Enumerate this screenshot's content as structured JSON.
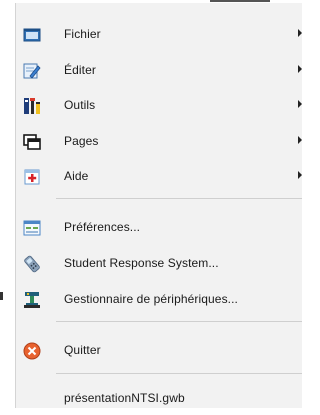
{
  "menu": {
    "items": [
      {
        "label": "Fichier",
        "icon": "folder-icon",
        "submenu": true
      },
      {
        "label": "Éditer",
        "icon": "edit-icon",
        "submenu": true
      },
      {
        "label": "Outils",
        "icon": "tools-icon",
        "submenu": true
      },
      {
        "label": "Pages",
        "icon": "pages-icon",
        "submenu": true
      },
      {
        "label": "Aide",
        "icon": "help-icon",
        "submenu": true
      },
      {
        "label": "Préférences...",
        "icon": "preferences-icon",
        "submenu": false
      },
      {
        "label": "Student Response System...",
        "icon": "response-system-icon",
        "submenu": false
      },
      {
        "label": "Gestionnaire de périphériques...",
        "icon": "device-manager-icon",
        "submenu": false
      },
      {
        "label": "Quitter",
        "icon": "quit-icon",
        "submenu": false
      },
      {
        "label": "présentationNTSI.gwb",
        "icon": "",
        "submenu": false
      }
    ]
  }
}
